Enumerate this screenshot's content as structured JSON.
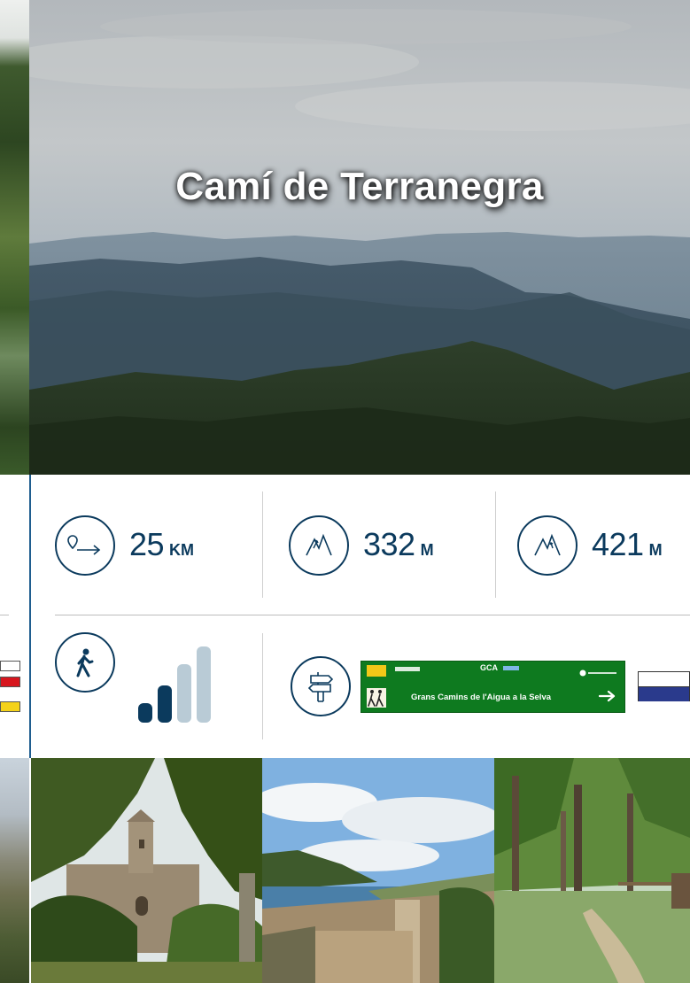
{
  "route": {
    "title": "Camí de Terranegra"
  },
  "stats": [
    {
      "icon": "route-distance-icon",
      "value": "25",
      "unit": "KM"
    },
    {
      "icon": "elevation-gain-icon",
      "value": "332",
      "unit": "M"
    },
    {
      "icon": "max-altitude-icon",
      "value": "421",
      "unit": "M"
    }
  ],
  "difficulty": {
    "icon": "hiker-icon",
    "level": 2,
    "max": 4,
    "color_on": "#0b3a5d",
    "color_off": "#b9cbd6"
  },
  "signage": {
    "icon": "signpost-icon",
    "sign_code": "GCA",
    "sign_text": "Grans Camins de l'Aigua a la Selva",
    "sign_color": "#0e7a1f"
  },
  "colors": {
    "primary": "#0b3a5d",
    "spine": "#1f5d8f",
    "divider": "#cfcfcf"
  }
}
